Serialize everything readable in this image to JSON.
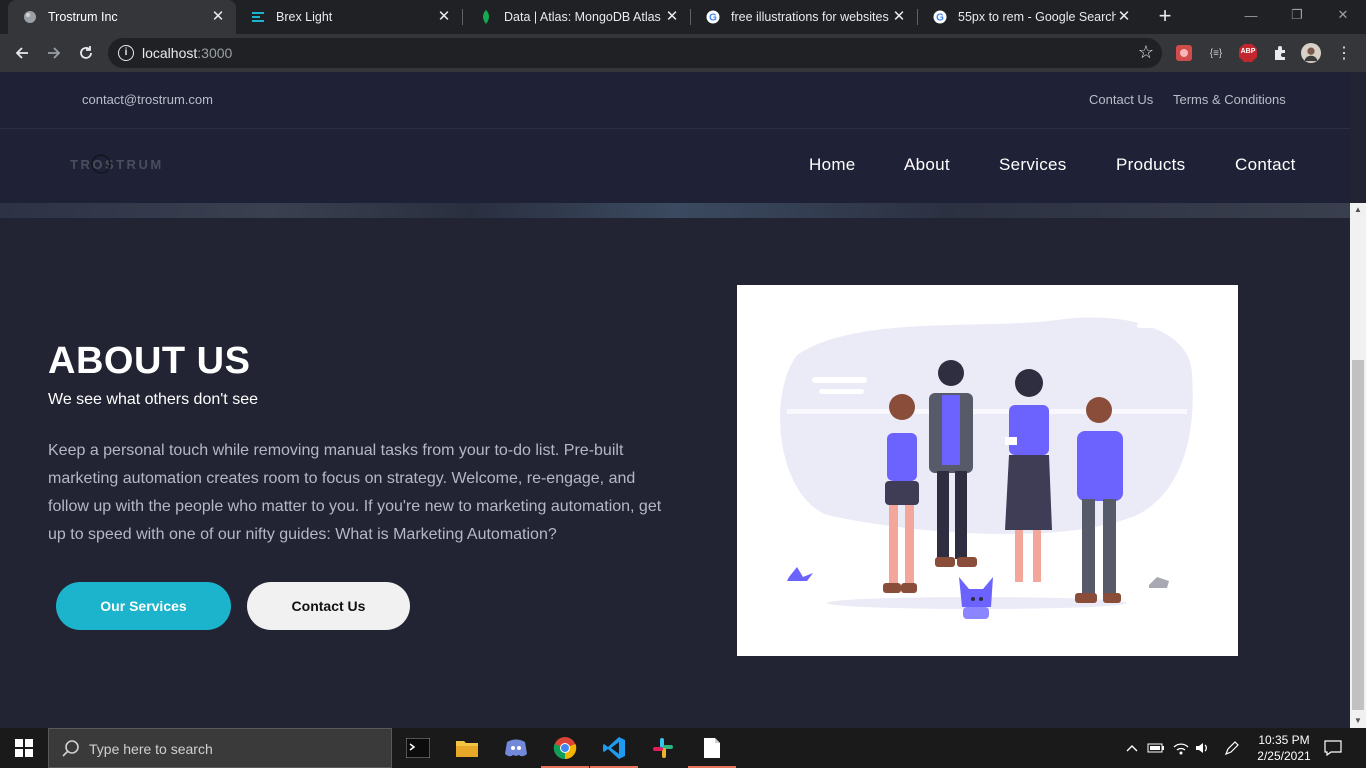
{
  "browser": {
    "tabs": [
      {
        "title": "Trostrum Inc",
        "icon": "globe-icon",
        "active": true
      },
      {
        "title": "Brex Light",
        "icon": "brex-icon",
        "active": false
      },
      {
        "title": "Data | Atlas: MongoDB Atlas",
        "icon": "mongodb-leaf-icon",
        "active": false
      },
      {
        "title": "free illustrations for websites -",
        "icon": "google-icon",
        "active": false
      },
      {
        "title": "55px to rem - Google Search",
        "icon": "google-icon",
        "active": false
      }
    ],
    "address": {
      "host": "localhost",
      "port": ":3000"
    },
    "extensions": [
      "extension-red-icon",
      "extension-code-icon",
      "adblock-icon",
      "puzzle-icon",
      "profile-avatar",
      "menu-icon"
    ],
    "abp_label": "ABP",
    "ext_code_label": "{≡}"
  },
  "site": {
    "topbar": {
      "email": "contact@trostrum.com",
      "links": [
        "Contact Us",
        "Terms & Conditions"
      ]
    },
    "logo_text": "TROSTRUM",
    "nav": [
      "Home",
      "About",
      "Services",
      "Products",
      "Contact"
    ],
    "about": {
      "title": "ABOUT US",
      "subtitle": "We see what others don't see",
      "body": "Keep a personal touch while removing manual tasks from your to-do list. Pre-built marketing automation creates room to focus on strategy. Welcome, re-engage, and follow up with the people who matter to you. If you're new to marketing automation, get up to speed with one of our nifty guides: What is Marketing Automation?",
      "primary_button": "Our Services",
      "secondary_button": "Contact Us"
    }
  },
  "taskbar": {
    "search_placeholder": "Type here to search",
    "apps": [
      "terminal-icon",
      "file-explorer-icon",
      "discord-icon",
      "chrome-icon",
      "vscode-icon",
      "slack-icon",
      "notepad-icon"
    ],
    "time": "10:35 PM",
    "date": "2/25/2021"
  },
  "colors": {
    "accent": "#1cb3cc",
    "background": "#232433",
    "header": "#1f2236"
  }
}
